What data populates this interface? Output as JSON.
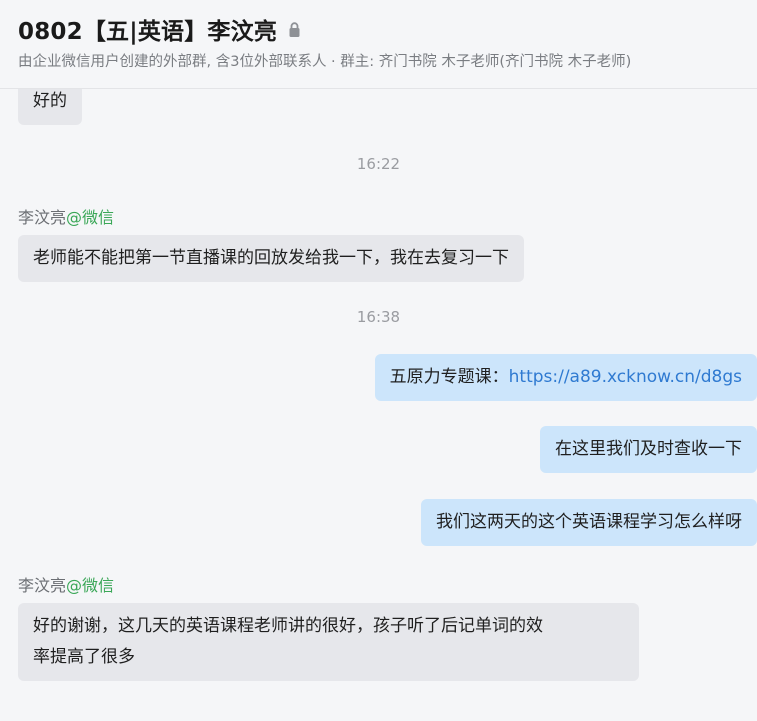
{
  "header": {
    "title": "0802【五|英语】李汶亮",
    "subtitle": "由企业微信用户创建的外部群, 含3位外部联系人 · 群主: 齐门书院 木子老师(齐门书院 木子老师)"
  },
  "messages": [
    {
      "type": "in",
      "text": "好的"
    },
    {
      "type": "time",
      "text": "16:22"
    },
    {
      "type": "in",
      "sender": "李汶亮",
      "sender_tag": "@微信",
      "text": "老师能不能把第一节直播课的回放发给我一下，我在去复习一下"
    },
    {
      "type": "time",
      "text": "16:38"
    },
    {
      "type": "out",
      "prefix": "五原力专题课：",
      "link": "https://a89.xcknow.cn/d8gs"
    },
    {
      "type": "out",
      "text": "在这里我们及时查收一下"
    },
    {
      "type": "out",
      "text": "我们这两天的这个英语课程学习怎么样呀"
    },
    {
      "type": "in",
      "sender": "李汶亮",
      "sender_tag": "@微信",
      "text_line1": "好的谢谢，这几天的英语课程老师讲的很好，孩子听了后记单词的效",
      "text_line2": "率提高了很多"
    }
  ],
  "colors": {
    "incoming_bubble": "#e6e7eb",
    "outgoing_bubble": "#cce5fb",
    "link": "#2f7ad1",
    "sender_tag": "#3aa757"
  },
  "icons": {
    "lock": "lock-icon"
  }
}
